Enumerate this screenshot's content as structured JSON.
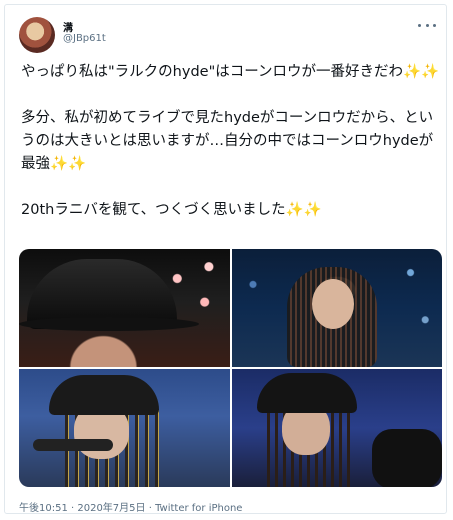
{
  "author": {
    "display_name": "溝",
    "handle": "@JBp61t"
  },
  "tweet": {
    "text": "やっぱり私は\"ラルクのhyde\"はコーンロウが一番好きだわ✨✨\n\n多分、私が初めてライブで見たhydeがコーンロウだから、というのは大きいとは思いますが…自分の中ではコーンロウhydeが最強✨✨\n\n20thラニバを観て、つくづく思いました✨✨"
  },
  "meta": {
    "time": "午後10:51 · 2020年7月5日 · ",
    "source": "Twitter for iPhone"
  },
  "media": {
    "count": 4
  },
  "colors": {
    "text": "#0f1419",
    "secondary": "#5b7083",
    "border": "#e1e8ed"
  },
  "icons": [
    "more-icon"
  ]
}
